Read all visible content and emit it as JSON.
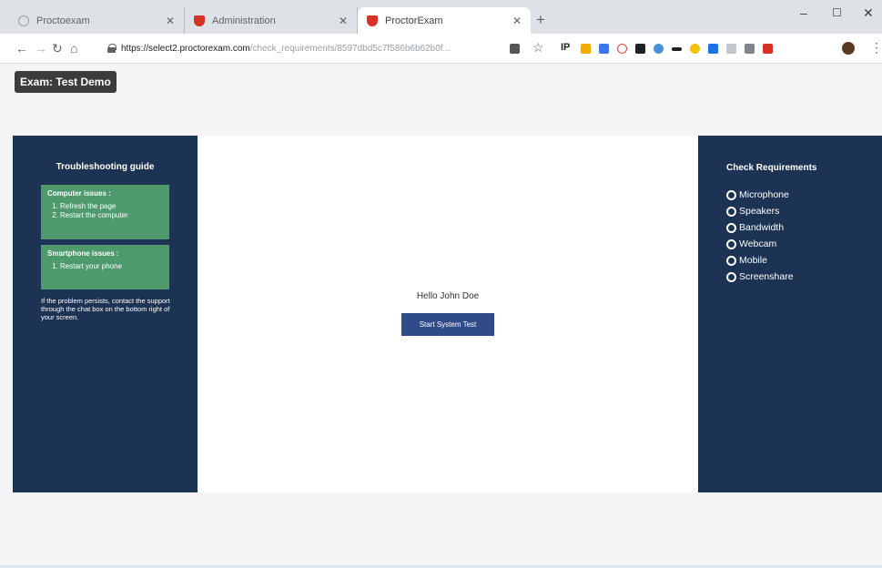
{
  "browser": {
    "tabs": [
      {
        "label": "Proctoexam",
        "active": false
      },
      {
        "label": "Administration",
        "active": false
      },
      {
        "label": "ProctorExam",
        "active": true
      }
    ],
    "url_host": "https://select2.proctorexam.com",
    "url_path": "/check_requirements/8597dbd5c7f586b6b62b0f...",
    "window_controls": {
      "minimize": "–",
      "maximize": "☐",
      "close": "✕"
    },
    "ext_ip": "IP",
    "new_tab": "+",
    "nav": {
      "back": "←",
      "forward": "→",
      "reload": "↻",
      "home": "⌂"
    },
    "star": "☆",
    "menu": "⋮",
    "colors": {
      "tab_strip": "#dee1e6",
      "shield_favicon": "#d93025"
    }
  },
  "exam": {
    "title": "Exam: Test Demo"
  },
  "guide": {
    "title": "Troubleshooting guide",
    "computer": {
      "title": "Computer issues :",
      "steps": [
        "Refresh the page",
        "Restart the computer"
      ]
    },
    "phone": {
      "title": "Smartphone issues :",
      "steps": [
        "Restart your phone"
      ]
    },
    "support": "If the problem persists, contact the support through the chat box on the bottom right of your screen."
  },
  "center": {
    "greeting": "Hello John Doe",
    "start_button": "Start System Test"
  },
  "requirements": {
    "title": "Check Requirements",
    "items": [
      "Microphone",
      "Speakers",
      "Bandwidth",
      "Webcam",
      "Mobile",
      "Screenshare"
    ]
  },
  "colors": {
    "panel": "#1d3353",
    "issue_box": "#4e9a6d",
    "button": "#2f4b8a",
    "exam_badge": "#3c3c3c"
  }
}
